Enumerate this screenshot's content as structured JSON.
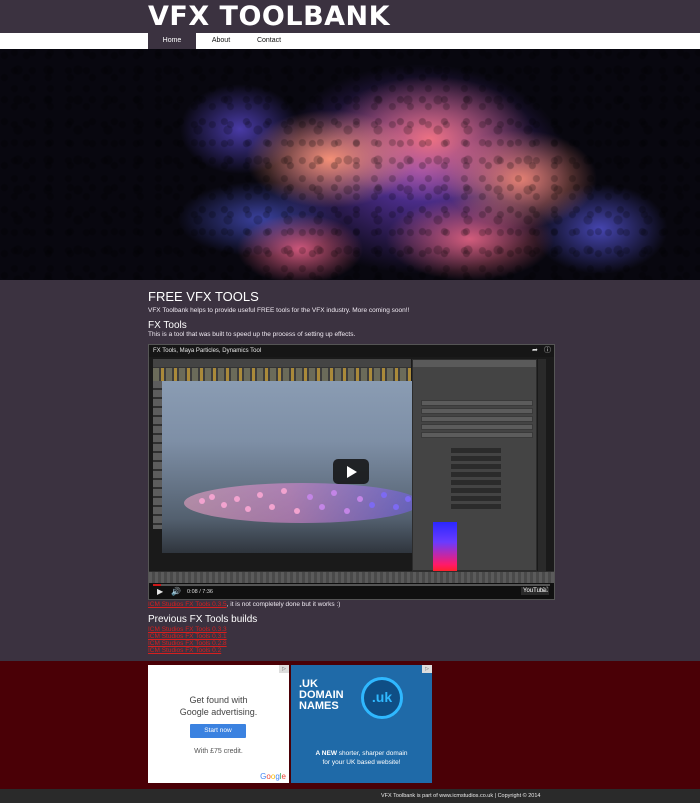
{
  "site": {
    "title": "VFX TOOLBANK"
  },
  "nav": {
    "items": [
      {
        "label": "Home",
        "active": true
      },
      {
        "label": "About",
        "active": false
      },
      {
        "label": "Contact",
        "active": false
      }
    ]
  },
  "main": {
    "heading": "FREE VFX TOOLS",
    "intro": "VFX Toolbank helps to provide useful FREE tools for the VFX industry. More coming soon!!",
    "fx_heading": "FX Tools",
    "fx_description": "This is a tool that was built to speed up the process of setting up effects."
  },
  "video": {
    "title": "FX Tools, Maya Particles, Dynamics Tool",
    "time": "0:08 / 7:36",
    "progress": 0.02,
    "brand": "YouTube",
    "icons": [
      "share-icon",
      "info-icon",
      "play-icon",
      "volume-icon",
      "fullscreen-icon"
    ]
  },
  "download": {
    "link": "ICM Studios FX Tools 0.3.5",
    "text": ", it is not completely done but it works :)"
  },
  "previous": {
    "heading": "Previous FX Tools builds",
    "builds": [
      "ICM Studios FX Tools 0.3.3",
      "ICM Studios FX Tools 0.3.1",
      "ICM Studios FX Tools 0.2.8",
      "ICM Studios FX Tools 0.2"
    ]
  },
  "ads": {
    "google": {
      "line1": "Get found with",
      "line2": "Google advertising.",
      "button": "Start now",
      "credit": "With £75 credit.",
      "logo": "Google"
    },
    "uk": {
      "title": ".UK DOMAIN NAMES",
      "circle": ".uk",
      "tagline_bold": "A NEW",
      "tagline_rest": " shorter, sharper domain",
      "tagline_line2": "for your UK based website!"
    }
  },
  "footer": {
    "text": "VFX Toolbank is part of www.icmstudios.co.uk | Copyright © 2014"
  },
  "colors": {
    "background": "#3b3240",
    "link_red": "#d61f1f",
    "ads_band": "#4a0006",
    "nav_active": "#3b3240"
  }
}
